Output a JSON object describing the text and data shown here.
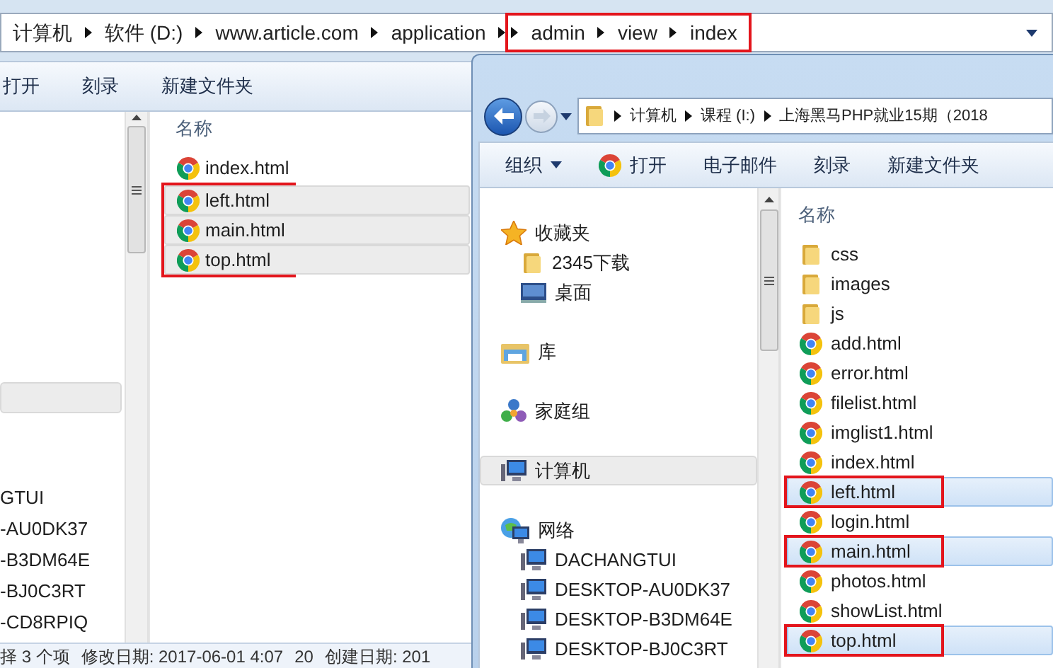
{
  "back_window": {
    "address_bar": {
      "crumbs": [
        {
          "label": "计算机",
          "boxed": false
        },
        {
          "label": "软件 (D:)",
          "boxed": false
        },
        {
          "label": "www.article.com",
          "boxed": false
        },
        {
          "label": "application",
          "boxed": false
        },
        {
          "label": "admin",
          "boxed": true
        },
        {
          "label": "view",
          "boxed": true
        },
        {
          "label": "index",
          "boxed": true
        }
      ]
    },
    "toolbar": [
      "打开",
      "刻录",
      "新建文件夹"
    ],
    "nav_pane": {
      "items": [
        {
          "label": "GTUI"
        },
        {
          "label": "-AU0DK37"
        },
        {
          "label": "-B3DM64E"
        },
        {
          "label": "-BJ0C3RT"
        },
        {
          "label": "-CD8RPIQ"
        }
      ]
    },
    "files": {
      "header": "名称",
      "items": [
        {
          "name": "index.html",
          "selected": false,
          "boxed": false
        },
        {
          "name": "left.html",
          "selected": true,
          "boxed": true
        },
        {
          "name": "main.html",
          "selected": true,
          "boxed": true
        },
        {
          "name": "top.html",
          "selected": true,
          "boxed": true
        }
      ]
    },
    "status_bar": [
      "择 3 个项",
      "修改日期: 2017-06-01 4:07",
      "20",
      "创建日期: 201"
    ]
  },
  "front_window": {
    "address_bar": {
      "crumbs": [
        "计算机",
        "课程 (I:)",
        "上海黑马PHP就业15期（2018"
      ]
    },
    "toolbar": [
      {
        "label": "组织",
        "kind": "menu"
      },
      {
        "label": "打开",
        "kind": "open"
      },
      {
        "label": "电子邮件",
        "kind": "plain"
      },
      {
        "label": "刻录",
        "kind": "plain"
      },
      {
        "label": "新建文件夹",
        "kind": "plain"
      }
    ],
    "nav_pane": {
      "groups": [
        {
          "label": "收藏夹",
          "kind": "favorites",
          "selected": false,
          "children": [
            {
              "label": "2345下载",
              "kind": "folder",
              "selected": false
            },
            {
              "label": "桌面",
              "kind": "desktop",
              "selected": false
            }
          ]
        },
        {
          "label": "库",
          "kind": "library",
          "selected": false
        },
        {
          "label": "家庭组",
          "kind": "homegroup",
          "selected": false
        },
        {
          "label": "计算机",
          "kind": "computer",
          "selected": true
        },
        {
          "label": "网络",
          "kind": "network",
          "selected": false,
          "children": [
            {
              "label": "DACHANGTUI",
              "kind": "computer",
              "selected": false
            },
            {
              "label": "DESKTOP-AU0DK37",
              "kind": "computer",
              "selected": false
            },
            {
              "label": "DESKTOP-B3DM64E",
              "kind": "computer",
              "selected": false
            },
            {
              "label": "DESKTOP-BJ0C3RT",
              "kind": "computer",
              "selected": false
            }
          ]
        }
      ]
    },
    "files": {
      "header": "名称",
      "items": [
        {
          "name": "css",
          "kind": "folder",
          "selected": false,
          "boxed": false
        },
        {
          "name": "images",
          "kind": "folder",
          "selected": false,
          "boxed": false
        },
        {
          "name": "js",
          "kind": "folder",
          "selected": false,
          "boxed": false
        },
        {
          "name": "add.html",
          "kind": "html",
          "selected": false,
          "boxed": false
        },
        {
          "name": "error.html",
          "kind": "html",
          "selected": false,
          "boxed": false
        },
        {
          "name": "filelist.html",
          "kind": "html",
          "selected": false,
          "boxed": false
        },
        {
          "name": "imglist1.html",
          "kind": "html",
          "selected": false,
          "boxed": false
        },
        {
          "name": "index.html",
          "kind": "html",
          "selected": false,
          "boxed": false
        },
        {
          "name": "left.html",
          "kind": "html",
          "selected": true,
          "boxed": true
        },
        {
          "name": "login.html",
          "kind": "html",
          "selected": false,
          "boxed": false
        },
        {
          "name": "main.html",
          "kind": "html",
          "selected": true,
          "boxed": true
        },
        {
          "name": "photos.html",
          "kind": "html",
          "selected": false,
          "boxed": false
        },
        {
          "name": "showList.html",
          "kind": "html",
          "selected": false,
          "boxed": false
        },
        {
          "name": "top.html",
          "kind": "html",
          "selected": true,
          "boxed": true
        }
      ]
    }
  }
}
